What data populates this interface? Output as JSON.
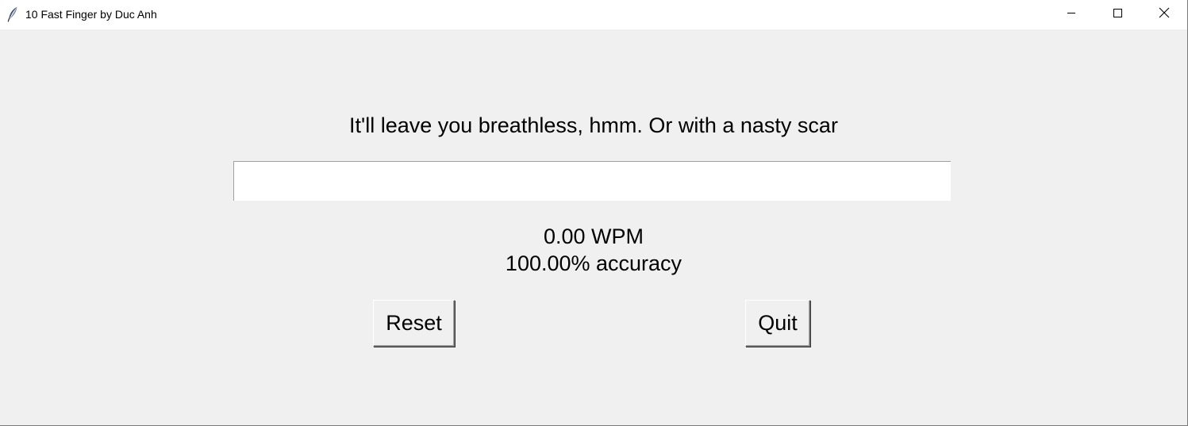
{
  "window": {
    "title": "10 Fast Finger by Duc Anh",
    "app_icon": "feather-icon",
    "controls": [
      "minimize-icon",
      "maximize-icon",
      "close-icon"
    ]
  },
  "main": {
    "sentence": "It'll leave you breathless, hmm. Or with a nasty scar",
    "input_value": "",
    "wpm": "0.00 WPM",
    "accuracy": "100.00% accuracy",
    "reset_label": "Reset",
    "quit_label": "Quit"
  }
}
